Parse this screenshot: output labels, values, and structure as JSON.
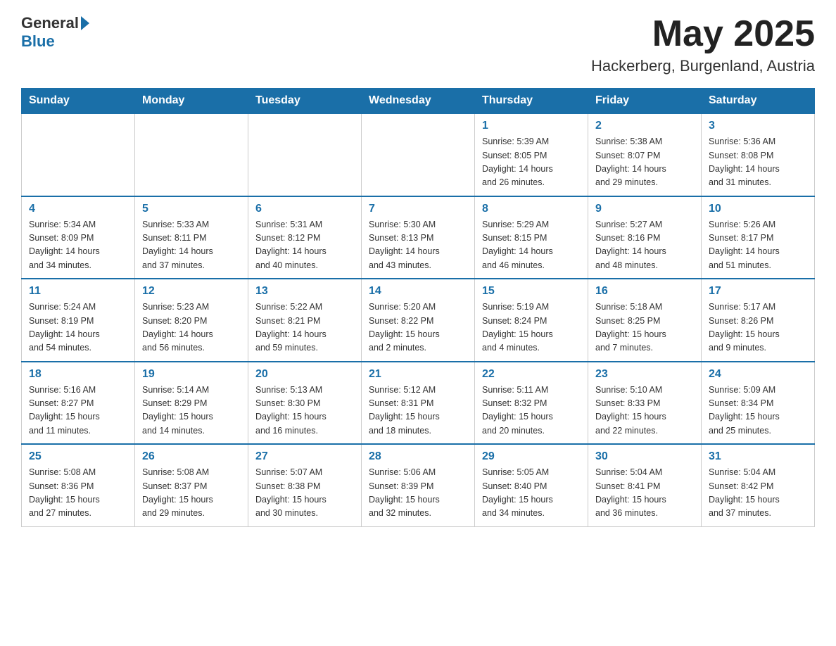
{
  "header": {
    "logo_general": "General",
    "logo_blue": "Blue",
    "month_year": "May 2025",
    "location": "Hackerberg, Burgenland, Austria"
  },
  "days_of_week": [
    "Sunday",
    "Monday",
    "Tuesday",
    "Wednesday",
    "Thursday",
    "Friday",
    "Saturday"
  ],
  "weeks": [
    [
      {
        "day": "",
        "info": ""
      },
      {
        "day": "",
        "info": ""
      },
      {
        "day": "",
        "info": ""
      },
      {
        "day": "",
        "info": ""
      },
      {
        "day": "1",
        "info": "Sunrise: 5:39 AM\nSunset: 8:05 PM\nDaylight: 14 hours\nand 26 minutes."
      },
      {
        "day": "2",
        "info": "Sunrise: 5:38 AM\nSunset: 8:07 PM\nDaylight: 14 hours\nand 29 minutes."
      },
      {
        "day": "3",
        "info": "Sunrise: 5:36 AM\nSunset: 8:08 PM\nDaylight: 14 hours\nand 31 minutes."
      }
    ],
    [
      {
        "day": "4",
        "info": "Sunrise: 5:34 AM\nSunset: 8:09 PM\nDaylight: 14 hours\nand 34 minutes."
      },
      {
        "day": "5",
        "info": "Sunrise: 5:33 AM\nSunset: 8:11 PM\nDaylight: 14 hours\nand 37 minutes."
      },
      {
        "day": "6",
        "info": "Sunrise: 5:31 AM\nSunset: 8:12 PM\nDaylight: 14 hours\nand 40 minutes."
      },
      {
        "day": "7",
        "info": "Sunrise: 5:30 AM\nSunset: 8:13 PM\nDaylight: 14 hours\nand 43 minutes."
      },
      {
        "day": "8",
        "info": "Sunrise: 5:29 AM\nSunset: 8:15 PM\nDaylight: 14 hours\nand 46 minutes."
      },
      {
        "day": "9",
        "info": "Sunrise: 5:27 AM\nSunset: 8:16 PM\nDaylight: 14 hours\nand 48 minutes."
      },
      {
        "day": "10",
        "info": "Sunrise: 5:26 AM\nSunset: 8:17 PM\nDaylight: 14 hours\nand 51 minutes."
      }
    ],
    [
      {
        "day": "11",
        "info": "Sunrise: 5:24 AM\nSunset: 8:19 PM\nDaylight: 14 hours\nand 54 minutes."
      },
      {
        "day": "12",
        "info": "Sunrise: 5:23 AM\nSunset: 8:20 PM\nDaylight: 14 hours\nand 56 minutes."
      },
      {
        "day": "13",
        "info": "Sunrise: 5:22 AM\nSunset: 8:21 PM\nDaylight: 14 hours\nand 59 minutes."
      },
      {
        "day": "14",
        "info": "Sunrise: 5:20 AM\nSunset: 8:22 PM\nDaylight: 15 hours\nand 2 minutes."
      },
      {
        "day": "15",
        "info": "Sunrise: 5:19 AM\nSunset: 8:24 PM\nDaylight: 15 hours\nand 4 minutes."
      },
      {
        "day": "16",
        "info": "Sunrise: 5:18 AM\nSunset: 8:25 PM\nDaylight: 15 hours\nand 7 minutes."
      },
      {
        "day": "17",
        "info": "Sunrise: 5:17 AM\nSunset: 8:26 PM\nDaylight: 15 hours\nand 9 minutes."
      }
    ],
    [
      {
        "day": "18",
        "info": "Sunrise: 5:16 AM\nSunset: 8:27 PM\nDaylight: 15 hours\nand 11 minutes."
      },
      {
        "day": "19",
        "info": "Sunrise: 5:14 AM\nSunset: 8:29 PM\nDaylight: 15 hours\nand 14 minutes."
      },
      {
        "day": "20",
        "info": "Sunrise: 5:13 AM\nSunset: 8:30 PM\nDaylight: 15 hours\nand 16 minutes."
      },
      {
        "day": "21",
        "info": "Sunrise: 5:12 AM\nSunset: 8:31 PM\nDaylight: 15 hours\nand 18 minutes."
      },
      {
        "day": "22",
        "info": "Sunrise: 5:11 AM\nSunset: 8:32 PM\nDaylight: 15 hours\nand 20 minutes."
      },
      {
        "day": "23",
        "info": "Sunrise: 5:10 AM\nSunset: 8:33 PM\nDaylight: 15 hours\nand 22 minutes."
      },
      {
        "day": "24",
        "info": "Sunrise: 5:09 AM\nSunset: 8:34 PM\nDaylight: 15 hours\nand 25 minutes."
      }
    ],
    [
      {
        "day": "25",
        "info": "Sunrise: 5:08 AM\nSunset: 8:36 PM\nDaylight: 15 hours\nand 27 minutes."
      },
      {
        "day": "26",
        "info": "Sunrise: 5:08 AM\nSunset: 8:37 PM\nDaylight: 15 hours\nand 29 minutes."
      },
      {
        "day": "27",
        "info": "Sunrise: 5:07 AM\nSunset: 8:38 PM\nDaylight: 15 hours\nand 30 minutes."
      },
      {
        "day": "28",
        "info": "Sunrise: 5:06 AM\nSunset: 8:39 PM\nDaylight: 15 hours\nand 32 minutes."
      },
      {
        "day": "29",
        "info": "Sunrise: 5:05 AM\nSunset: 8:40 PM\nDaylight: 15 hours\nand 34 minutes."
      },
      {
        "day": "30",
        "info": "Sunrise: 5:04 AM\nSunset: 8:41 PM\nDaylight: 15 hours\nand 36 minutes."
      },
      {
        "day": "31",
        "info": "Sunrise: 5:04 AM\nSunset: 8:42 PM\nDaylight: 15 hours\nand 37 minutes."
      }
    ]
  ]
}
